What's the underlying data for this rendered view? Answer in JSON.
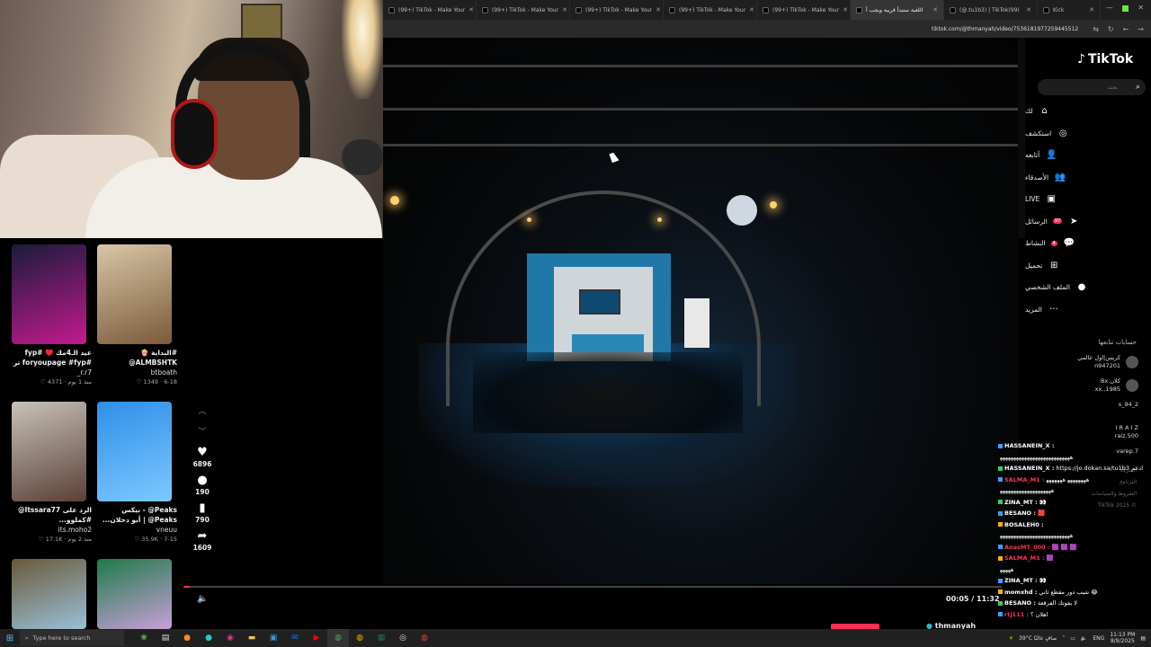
{
  "browser": {
    "tabs": [
      {
        "title": "(99+) TikTok - Make Your",
        "active": false
      },
      {
        "title": "(99+) TikTok - Make Your",
        "active": false
      },
      {
        "title": "(99+) TikTok - Make Your",
        "active": false
      },
      {
        "title": "(99+) TikTok - Make Your",
        "active": false
      },
      {
        "title": "(99+) TikTok - Make Your",
        "active": false
      },
      {
        "title": "اللعبة ستبدأ قريبة ويجب أ",
        "active": true
      },
      {
        "title": "(@.tu1b3) | TikTok(99)",
        "active": false
      },
      {
        "title": "Kick",
        "active": false
      }
    ],
    "url": "tiktok.com/@thmanyah/video/7536181977259445512"
  },
  "thumbnails": [
    {
      "title": "عيد الـ4مك ♥️ #fyp",
      "subtitle": "#foryoupage #fyp تر",
      "user": "r.r7_",
      "likes": "4371",
      "date": "منذ 1 يوم",
      "c1": "#1a1b3a",
      "c2": "#c31a8f"
    },
    {
      "title": "#البداية 🍿",
      "subtitle": "ALMBSHTK@",
      "user": "btboath",
      "likes": "1349",
      "date": "6-18",
      "c1": "#d9c6a8",
      "c2": "#7a5a3a"
    },
    {
      "title": "الرد على Itssara77@",
      "subtitle": "#كملوو...",
      "user": "its.moho2",
      "likes": "17.1K",
      "date": "منذ 2 يوم",
      "c1": "#c8c2b8",
      "c2": "#5a4036"
    },
    {
      "title": "Peaks@ - بيكس",
      "subtitle": "Peaks@ | أبو دحلان...",
      "user": "vneuu",
      "likes": "35.9K",
      "date": "7-15",
      "c1": "#2f8fe8",
      "c2": "#7dc8ff"
    },
    {
      "title": "",
      "subtitle": "",
      "user": "",
      "likes": "",
      "date": "",
      "c1": "#6a5a3a",
      "c2": "#9ac0d8"
    },
    {
      "title": "",
      "subtitle": "",
      "user": "",
      "likes": "",
      "date": "",
      "c1": "#1e7a4a",
      "c2": "#c8a0d8"
    }
  ],
  "actions": {
    "likes": "6896",
    "comments": "190",
    "saves": "790",
    "shares": "1609"
  },
  "player": {
    "time": "00:05 / 11:32",
    "progress": 0.0072,
    "author": "thmanyah"
  },
  "sidebar": {
    "logo": "TikTok",
    "search_placeholder": "بحث",
    "nav": [
      {
        "label": "لك",
        "icon": "⌂",
        "badge": ""
      },
      {
        "label": "استكشف",
        "icon": "◎",
        "badge": ""
      },
      {
        "label": "أتابعه",
        "icon": "👤",
        "badge": ""
      },
      {
        "label": "الأصدقاء",
        "icon": "👥",
        "badge": ""
      },
      {
        "label": "LIVE",
        "icon": "▣",
        "badge": ""
      },
      {
        "label": "الرسائل",
        "icon": "➤",
        "badge": "97"
      },
      {
        "label": "النشاط",
        "icon": "💬",
        "badge": "4"
      },
      {
        "label": "تحميل",
        "icon": "⊞",
        "badge": ""
      },
      {
        "label": "الملف الشخصي",
        "icon": "●",
        "badge": ""
      },
      {
        "label": "المزيد",
        "icon": "···",
        "badge": ""
      }
    ],
    "following_heading": "حسابات تتابعها",
    "following": [
      {
        "name": "كريس|اول عالمي",
        "handle": "n947201"
      },
      {
        "name": "Bx كلان",
        "handle": "xx..1985"
      },
      {
        "name": "s_94_2",
        "handle": ""
      },
      {
        "name": "I R A I Z",
        "handle": "raiz.500"
      },
      {
        "name": "",
        "handle": "varep.7"
      }
    ],
    "footer": [
      "الشركة",
      "البرنامج",
      "الشروط والسياسات",
      "TikTok 2025 ©"
    ]
  },
  "chat": [
    {
      "user": "HASSANEIN_X :",
      "text": "",
      "color": "#ffffff"
    },
    {
      "user": "",
      "text": "ه‍ه‍ه‍ه‍ه‍ه‍ه‍ه‍ه‍ه‍ه‍ه‍ه‍ه‍ه‍ه‍ه‍ه‍ه‍ه‍ه‍ه‍ه‍ه‍ه‍ه‍ه‍",
      "color": "#ffffff"
    },
    {
      "user": "HASSANEIN_X :",
      "text": "https://jo.dokan.sa/tu1b3 ادعم",
      "color": "#ffffff"
    },
    {
      "user": "SALMA_M1 :",
      "text": "ه‍ه‍ه‍ه‍ه‍ه‍ه‍ه‍ ه‍ه‍ه‍ه‍ه‍ه‍ه‍",
      "color": "#ff3355"
    },
    {
      "user": "",
      "text": "ه‍ه‍ه‍ه‍ه‍ه‍ه‍ه‍ه‍ه‍ه‍ه‍ه‍ه‍ه‍ه‍ه‍ه‍ه‍ه‍",
      "color": "#ffffff"
    },
    {
      "user": "ZINA_MT :",
      "text": "👀",
      "color": "#ffffff"
    },
    {
      "user": "BESANO :",
      "text": "🟥",
      "color": "#ffffff"
    },
    {
      "user": "BOSALEH0 :",
      "text": "",
      "color": "#ffffff"
    },
    {
      "user": "",
      "text": "ه‍ه‍ه‍ه‍ه‍ه‍ه‍ه‍ه‍ه‍ه‍ه‍ه‍ه‍ه‍ه‍ه‍ه‍ه‍ه‍ه‍ه‍ه‍ه‍ه‍ه‍ه‍",
      "color": "#ffffff"
    },
    {
      "user": "AnasMT_000 :",
      "text": "🟪 🟪 🟪",
      "color": "#ff3355"
    },
    {
      "user": "SALMA_M1 :",
      "text": "🟪",
      "color": "#ff3355"
    },
    {
      "user": "",
      "text": "ه‍ه‍ه‍ه‍ه‍",
      "color": "#ffffff"
    },
    {
      "user": "ZINA_MT :",
      "text": "👀",
      "color": "#ffffff"
    },
    {
      "user": "momxhd :",
      "text": "شيب دور مقطع ثاني 😂",
      "color": "#ffffff"
    },
    {
      "user": "BESANO :",
      "text": "لا يفوتك الفرقعة",
      "color": "#ffffff"
    },
    {
      "user": "rtj111 :",
      "text": "اهلان ؟",
      "color": "#ff3355"
    }
  ],
  "taskbar": {
    "search_placeholder": "Type here to search",
    "weather": "39°C صافٍ غالبًا",
    "lang": "ENG",
    "time": "11:13 PM",
    "date": "8/9/2025"
  }
}
